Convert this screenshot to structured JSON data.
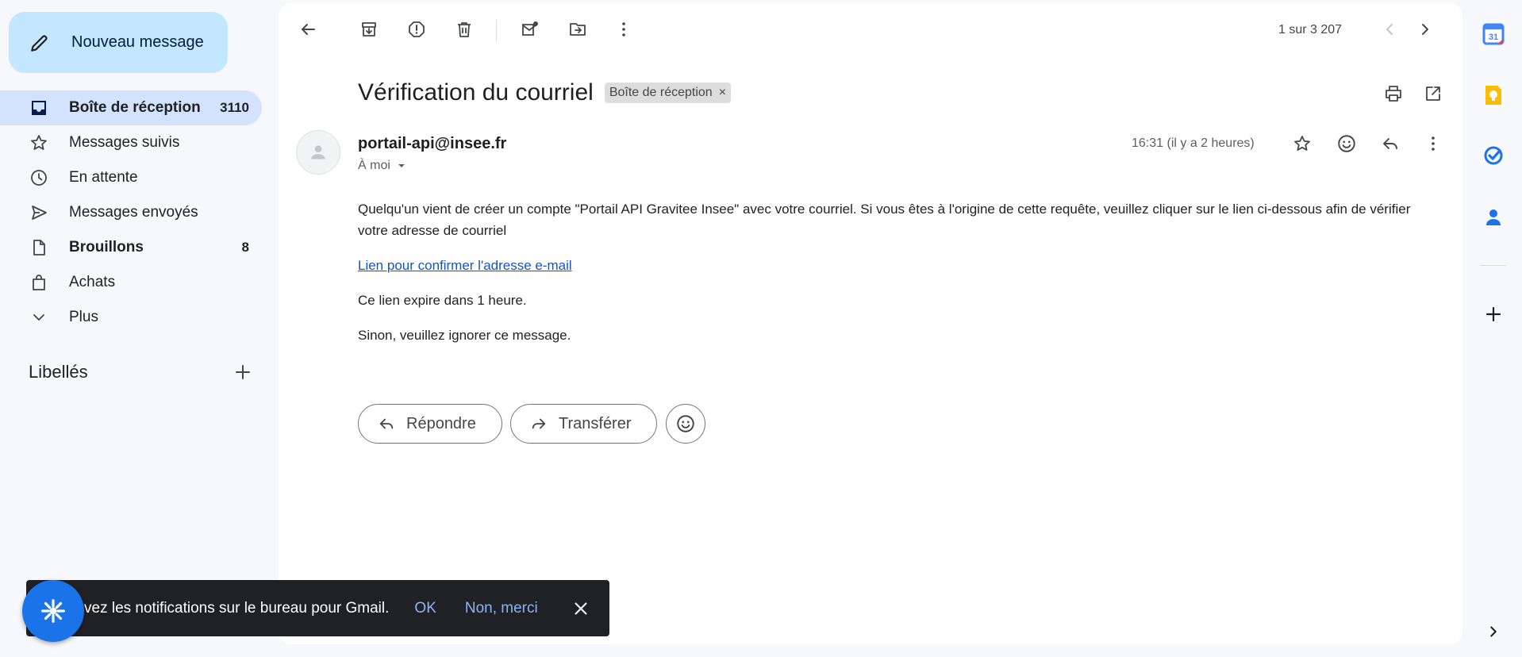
{
  "compose": {
    "label": "Nouveau message"
  },
  "nav": {
    "items": [
      {
        "label": "Boîte de réception",
        "count": "3110",
        "icon": "inbox-icon"
      },
      {
        "label": "Messages suivis",
        "count": "",
        "icon": "star-icon"
      },
      {
        "label": "En attente",
        "count": "",
        "icon": "clock-icon"
      },
      {
        "label": "Messages envoyés",
        "count": "",
        "icon": "send-icon"
      },
      {
        "label": "Brouillons",
        "count": "8",
        "icon": "draft-icon"
      },
      {
        "label": "Achats",
        "count": "",
        "icon": "shopping-bag-icon"
      },
      {
        "label": "Plus",
        "count": "",
        "icon": "chevron-down-icon"
      }
    ]
  },
  "labels": {
    "title": "Libellés"
  },
  "toolbar": {
    "pager": "1 sur 3 207"
  },
  "email": {
    "subject": "Vérification du courriel",
    "label_chip": "Boîte de réception",
    "chip_close": "×",
    "sender": "portail-api@insee.fr",
    "to": "À moi",
    "time": "16:31 (il y a 2 heures)",
    "body": {
      "paragraph1": "Quelqu'un vient de créer un compte \"Portail API Gravitee Insee\" avec votre courriel. Si vous êtes à l'origine de cette requête, veuillez cliquer sur le lien ci-dessous afin de vérifier votre adresse de courriel",
      "link": "Lien pour confirmer l'adresse e-mail",
      "paragraph2": "Ce lien expire dans 1 heure.",
      "paragraph3": "Sinon, veuillez ignorer ce message."
    }
  },
  "actions": {
    "reply": "Répondre",
    "forward": "Transférer"
  },
  "snackbar": {
    "message": "vez les notifications sur le bureau pour Gmail.",
    "ok": "OK",
    "decline": "Non, merci"
  },
  "rail": {
    "calendar_day": "31"
  },
  "colors": {
    "accent": "#0b57d0",
    "compose_bg": "#c2e7ff",
    "active_nav": "#d3e3fd",
    "link": "#1155cc",
    "snackbar_bg": "#202124",
    "snackbar_action": "#8ab4f8"
  }
}
